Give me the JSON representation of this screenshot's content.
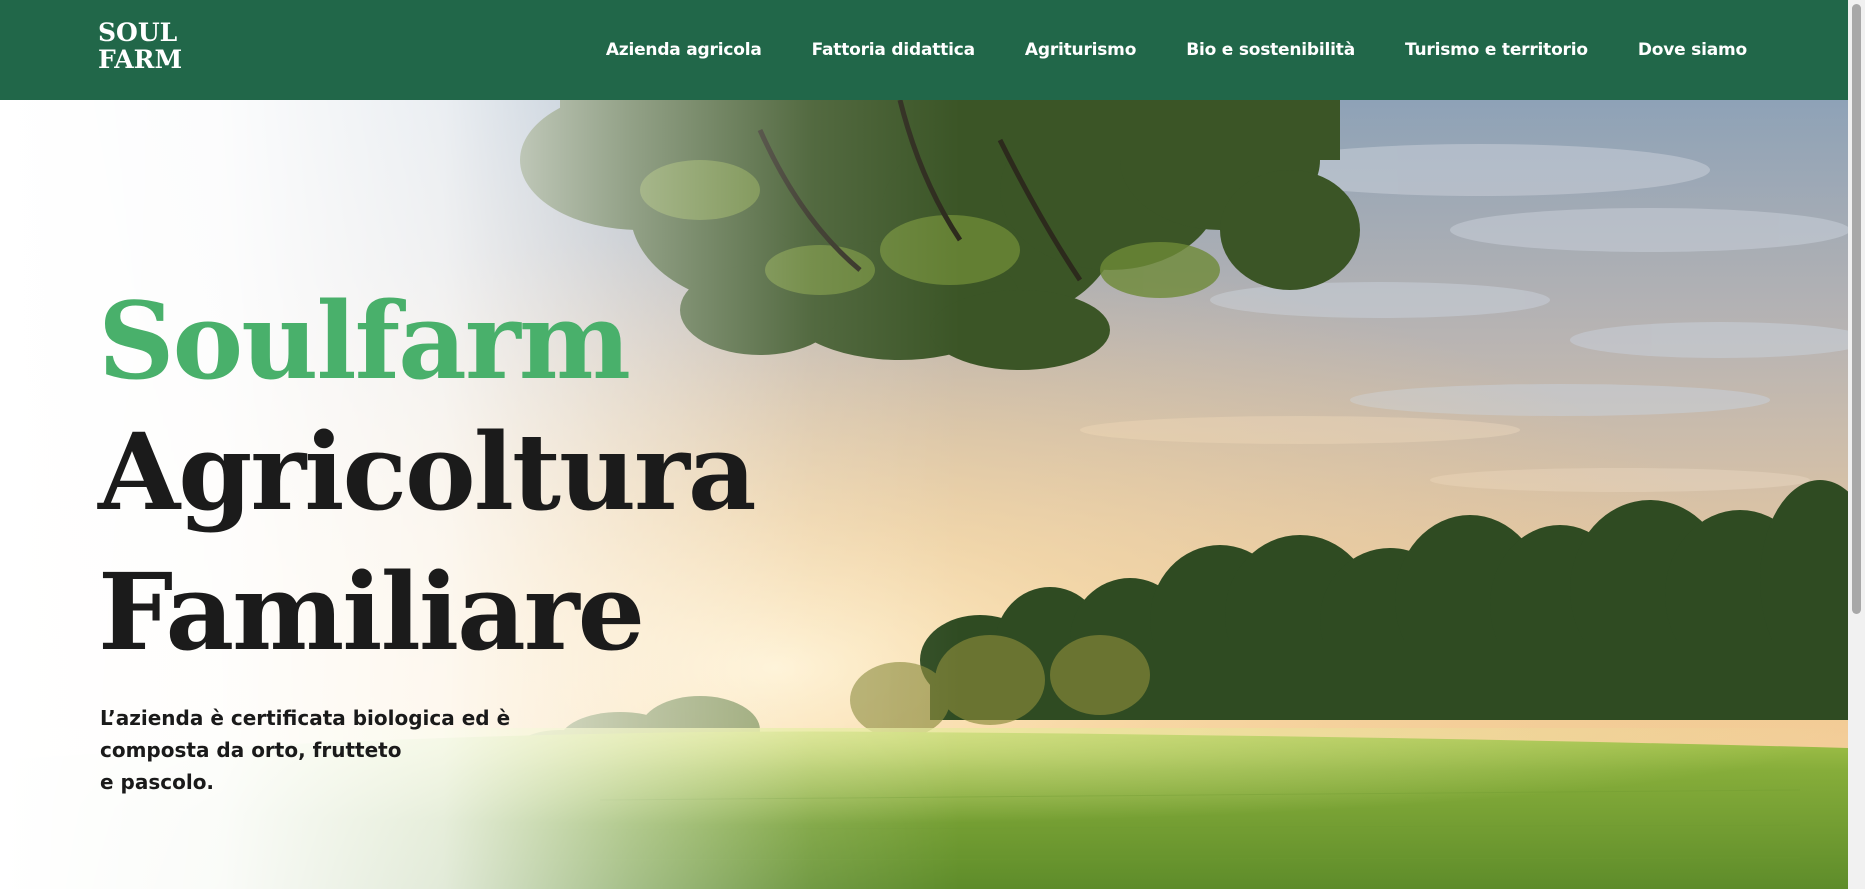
{
  "logo": {
    "line1": "SOUL",
    "line2": "FARM"
  },
  "nav": {
    "items": [
      {
        "label": "Azienda agricola"
      },
      {
        "label": "Fattoria didattica"
      },
      {
        "label": "Agriturismo"
      },
      {
        "label": "Bio e sostenibilità"
      },
      {
        "label": "Turismo e territorio"
      },
      {
        "label": "Dove siamo"
      }
    ]
  },
  "hero": {
    "brand": "Soulfarm",
    "line1": "Agricoltura",
    "line2": "Familiare",
    "description_lines": [
      "L’azienda è certificata biologica ed è",
      "composta da orto, frutteto",
      "e pascolo."
    ]
  },
  "colors": {
    "navbar": "#216749",
    "brand_green": "#49b06b",
    "heading": "#1b1b1b",
    "text": "#1a1a1a"
  }
}
